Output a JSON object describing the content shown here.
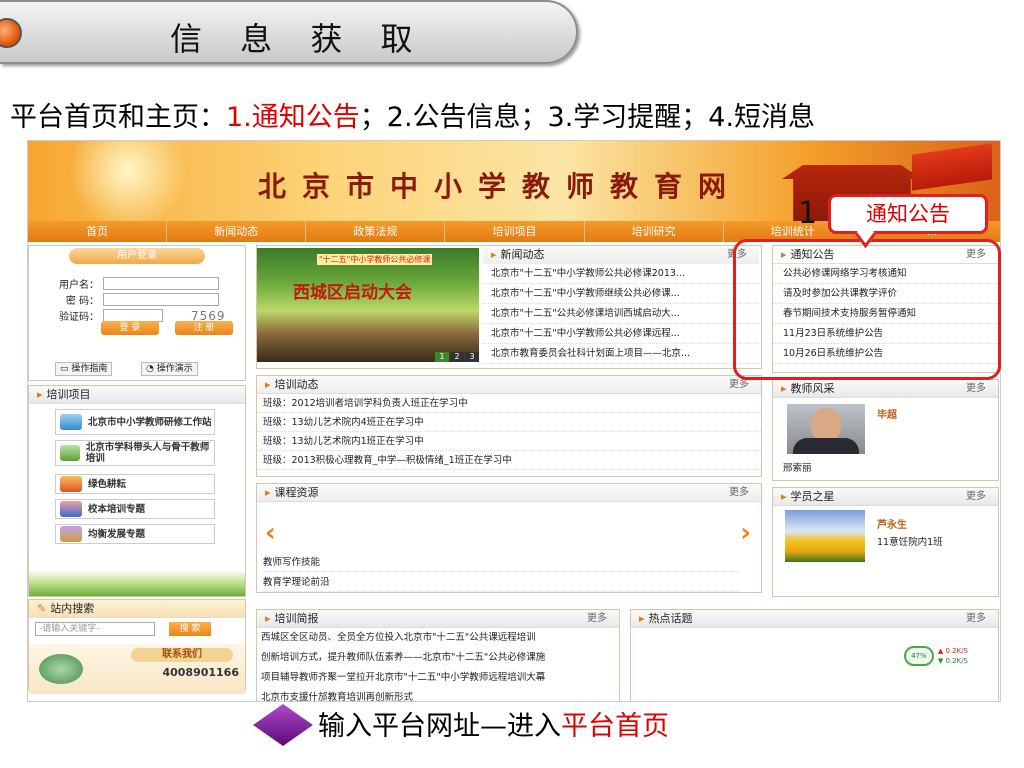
{
  "slide": {
    "title": "信 息 获 取",
    "subtitle_parts": [
      "平台首页和主页：",
      "1.通知公告",
      "；2.公告信息；3.学习提醒；4.短消息"
    ],
    "callout_number": "1",
    "callout_label": "通知公告",
    "footer_parts": [
      "输入平台网址—进入",
      "平台首页"
    ]
  },
  "site": {
    "title": "北京市中小学教师教育网",
    "nav": [
      "首页",
      "新闻动态",
      "政策法规",
      "培训项目",
      "培训研究",
      "培训统计",
      "..."
    ],
    "login": {
      "header": "用户登录",
      "username_label": "用户名：",
      "password_label": "密 码：",
      "captcha_label": "验证码：",
      "captcha_value": "7569",
      "login_button": "登 录",
      "register_button": "注 册",
      "guide_button": "操作指南",
      "demo_button": "操作演示"
    },
    "projects": {
      "header": "培训项目",
      "items": [
        "北京市中小学教师研修工作站",
        "北京市学科带头人与骨干教师培训",
        "绿色耕耘",
        "校本培训专题",
        "均衡发展专题"
      ]
    },
    "search": {
      "header": "站内搜索",
      "placeholder": "-请输入关键字-",
      "button": "搜 索"
    },
    "contact": {
      "label": "联系我们",
      "phone": "4008901166"
    },
    "news": {
      "header": "新闻动态",
      "more": "更多",
      "photo_banner": "\"十二五\"中小学教师公共必修课",
      "photo_title": "西城区启动大会",
      "pager": [
        "1",
        "2",
        "3"
      ],
      "items": [
        "北京市\"十二五\"中小学教师公共必修课2013...",
        "北京市\"十二五\"中小学教师继续公共必修课...",
        "北京市\"十二五\"公共必修课培训西城启动大...",
        "北京市\"十二五\"中小学教师公共必修课远程...",
        "北京市教育委员会社科计划面上项目——北京..."
      ]
    },
    "notice": {
      "header": "通知公告",
      "more": "更多",
      "items": [
        "公共必修课网络学习考核通知",
        "请及时参加公共课教学评价",
        "春节期间技术支持服务暂停通知",
        "11月23日系统维护公告",
        "10月26日系统维护公告"
      ]
    },
    "training": {
      "header": "培训动态",
      "more": "更多",
      "items": [
        "班级：2012培训者培训学科负责人班正在学习中",
        "班级：13幼儿艺术院内4班正在学习中",
        "班级：13幼儿艺术院内1班正在学习中",
        "班级：2013积极心理教育_中学—积极情绪_1班正在学习中"
      ]
    },
    "teacher": {
      "header": "教师风采",
      "more": "更多",
      "name": "毕超",
      "caption": "邢索丽"
    },
    "course": {
      "header": "课程资源",
      "more": "更多",
      "items": [
        "教师写作技能",
        "教育学理论前沿"
      ]
    },
    "student": {
      "header": "学员之星",
      "more": "更多",
      "name": "芦永生",
      "class": "11意饪院内1班"
    },
    "brief": {
      "header": "培训简报",
      "more": "更多",
      "items": [
        "西城区全区动员、全员全方位投入北京市\"十二五\"公共课远程培训",
        "创新培训方式，提升教师队伍素养——北京市\"十二五\"公共必修课施",
        "项目辅导教师齐聚一堂拉开北京市\"十二五\"中小学教师远程培训大幕",
        "北京市支援什邡教育培训再创新形式"
      ]
    },
    "hot": {
      "header": "热点话题",
      "more": "更多",
      "gauge_percent": "47%",
      "up_rate": "0.2K/S",
      "down_rate": "0.2K/S"
    }
  }
}
